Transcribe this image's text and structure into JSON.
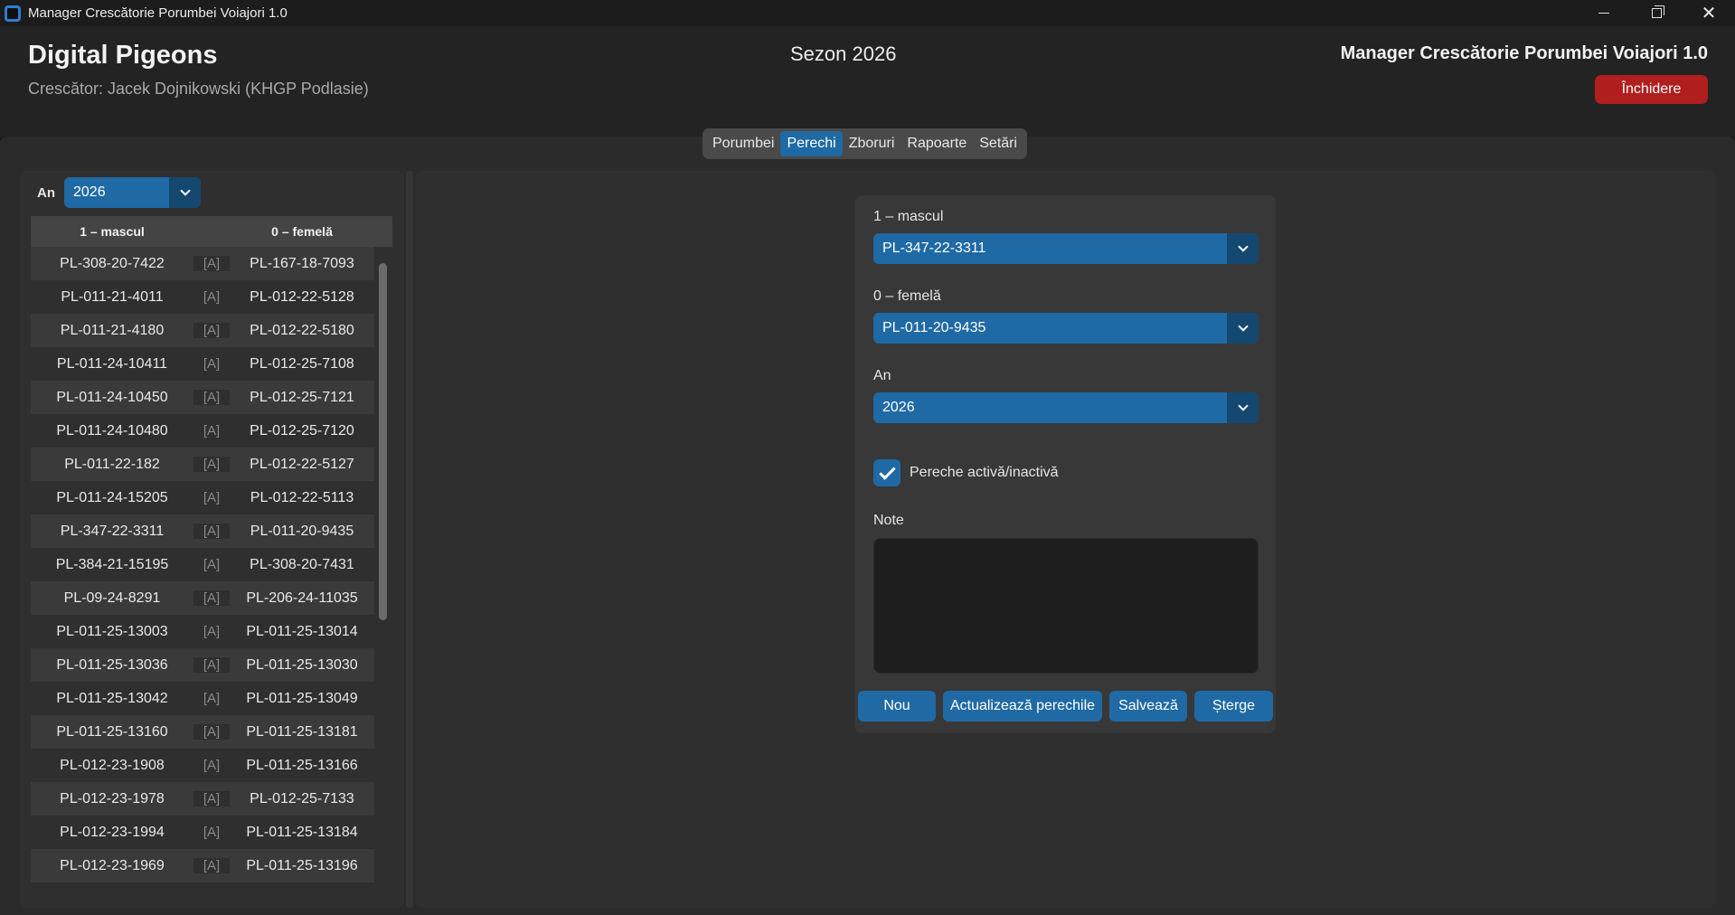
{
  "window": {
    "title": "Manager Crescătorie Porumbei Voiajori 1.0"
  },
  "header": {
    "brand": "Digital Pigeons",
    "breeder": "Crescător: Jacek Dojnikowski (KHGP Podlasie)",
    "season": "Sezon 2026",
    "app_title": "Manager Crescătorie Porumbei Voiajori 1.0",
    "close_label": "Închidere"
  },
  "tabs": [
    "Porumbei",
    "Perechi",
    "Zboruri",
    "Rapoarte",
    "Setări"
  ],
  "active_tab": "Perechi",
  "left": {
    "year_label": "An",
    "year_value": "2026",
    "col_male": "1 – mascul",
    "col_female": "0 – femelă",
    "rows": [
      {
        "m": "PL-308-20-7422",
        "s": "[A]",
        "f": "PL-167-18-7093"
      },
      {
        "m": "PL-011-21-4011",
        "s": "[A]",
        "f": "PL-012-22-5128"
      },
      {
        "m": "PL-011-21-4180",
        "s": "[A]",
        "f": "PL-012-22-5180"
      },
      {
        "m": "PL-011-24-10411",
        "s": "[A]",
        "f": "PL-012-25-7108"
      },
      {
        "m": "PL-011-24-10450",
        "s": "[A]",
        "f": "PL-012-25-7121"
      },
      {
        "m": "PL-011-24-10480",
        "s": "[A]",
        "f": "PL-012-25-7120"
      },
      {
        "m": "PL-011-22-182",
        "s": "[A]",
        "f": "PL-012-22-5127"
      },
      {
        "m": "PL-011-24-15205",
        "s": "[A]",
        "f": "PL-012-22-5113"
      },
      {
        "m": "PL-347-22-3311",
        "s": "[A]",
        "f": "PL-011-20-9435"
      },
      {
        "m": "PL-384-21-15195",
        "s": "[A]",
        "f": "PL-308-20-7431"
      },
      {
        "m": "PL-09-24-8291",
        "s": "[A]",
        "f": "PL-206-24-11035"
      },
      {
        "m": "PL-011-25-13003",
        "s": "[A]",
        "f": "PL-011-25-13014"
      },
      {
        "m": "PL-011-25-13036",
        "s": "[A]",
        "f": "PL-011-25-13030"
      },
      {
        "m": "PL-011-25-13042",
        "s": "[A]",
        "f": "PL-011-25-13049"
      },
      {
        "m": "PL-011-25-13160",
        "s": "[A]",
        "f": "PL-011-25-13181"
      },
      {
        "m": "PL-012-23-1908",
        "s": "[A]",
        "f": "PL-011-25-13166"
      },
      {
        "m": "PL-012-23-1978",
        "s": "[A]",
        "f": "PL-012-25-7133"
      },
      {
        "m": "PL-012-23-1994",
        "s": "[A]",
        "f": "PL-011-25-13184"
      },
      {
        "m": "PL-012-23-1969",
        "s": "[A]",
        "f": "PL-011-25-13196"
      }
    ]
  },
  "form": {
    "male_label": "1 – mascul",
    "male_value": "PL-347-22-3311",
    "female_label": "0 – femelă",
    "female_value": "PL-011-20-9435",
    "year_label": "An",
    "year_value": "2026",
    "active_label": "Pereche activă/inactivă",
    "active_checked": true,
    "notes_label": "Note",
    "notes_value": "",
    "btn_new": "Nou",
    "btn_update": "Actualizează perechile",
    "btn_save": "Salvează",
    "btn_delete": "Șterge"
  },
  "colors": {
    "accent": "#1f6aa5",
    "accent_dark": "#144870",
    "danger": "#b01e1e"
  }
}
